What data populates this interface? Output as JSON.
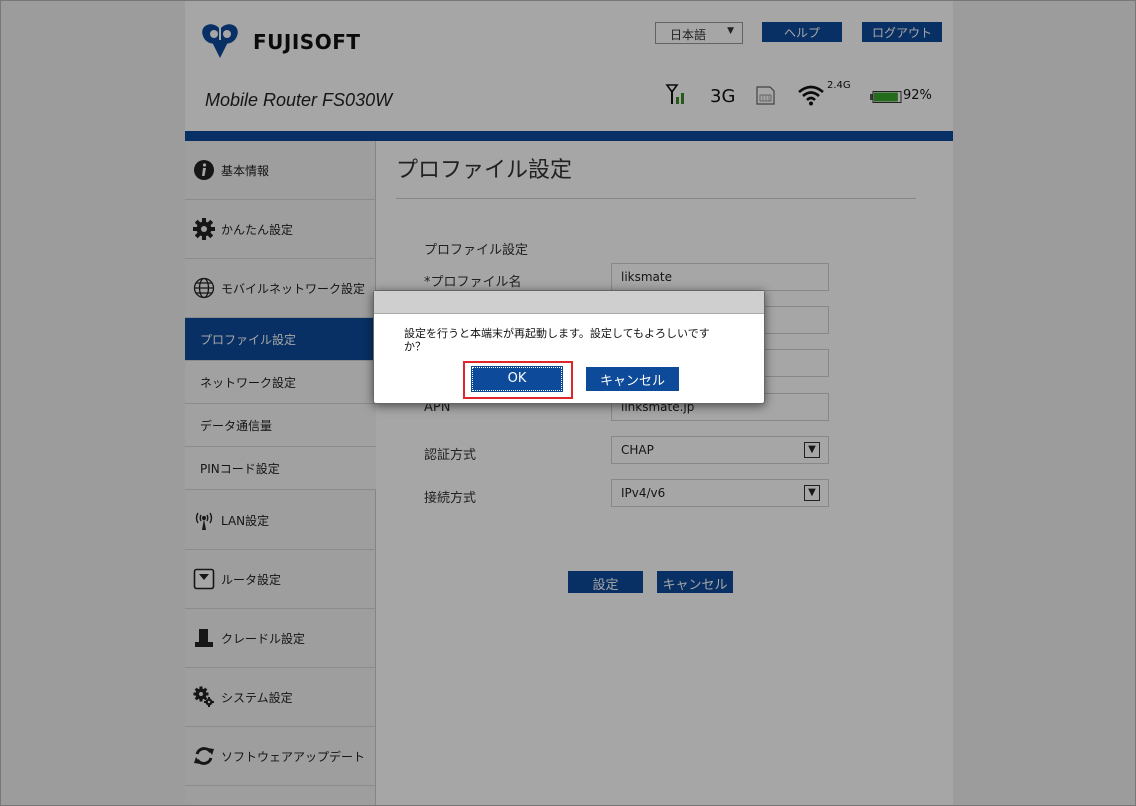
{
  "header": {
    "brand": "FUJISOFT",
    "model": "Mobile Router FS030W",
    "language": "日本語",
    "help_label": "ヘルプ",
    "logout_label": "ログアウト"
  },
  "status": {
    "network_type": "3G",
    "wifi_band": "2.4G",
    "battery_percent": "92%",
    "battery_level": 0.92
  },
  "sidebar": {
    "items": [
      {
        "label": "基本情報",
        "icon": "info-icon"
      },
      {
        "label": "かんたん設定",
        "icon": "gear-icon"
      },
      {
        "label": "モバイルネットワーク設定",
        "icon": "globe-icon"
      },
      {
        "label": "プロファイル設定"
      },
      {
        "label": "ネットワーク設定"
      },
      {
        "label": "データ通信量"
      },
      {
        "label": "PINコード設定"
      },
      {
        "label": "LAN設定",
        "icon": "antenna-icon"
      },
      {
        "label": "ルータ設定",
        "icon": "router-icon"
      },
      {
        "label": "クレードル設定",
        "icon": "cradle-icon"
      },
      {
        "label": "システム設定",
        "icon": "gears-icon"
      },
      {
        "label": "ソフトウェアアップデート",
        "icon": "refresh-icon"
      }
    ]
  },
  "main": {
    "title": "プロファイル設定",
    "section_label": "プロファイル設定",
    "profile_name_label": "*プロファイル名",
    "profile_name_value": "liksmate",
    "apn_label": "APN",
    "apn_value": "linksmate.jp",
    "auth_label": "認証方式",
    "auth_value": "CHAP",
    "conn_label": "接続方式",
    "conn_value": "IPv4/v6",
    "set_label": "設定",
    "cancel_label": "キャンセル"
  },
  "dialog": {
    "message": "設定を行うと本端末が再起動します。設定してもよろしいですか？",
    "ok_label": "OK",
    "cancel_label": "キャンセル"
  },
  "colors": {
    "brand_blue": "#0d4a9a",
    "highlight_red": "#e0262d"
  }
}
